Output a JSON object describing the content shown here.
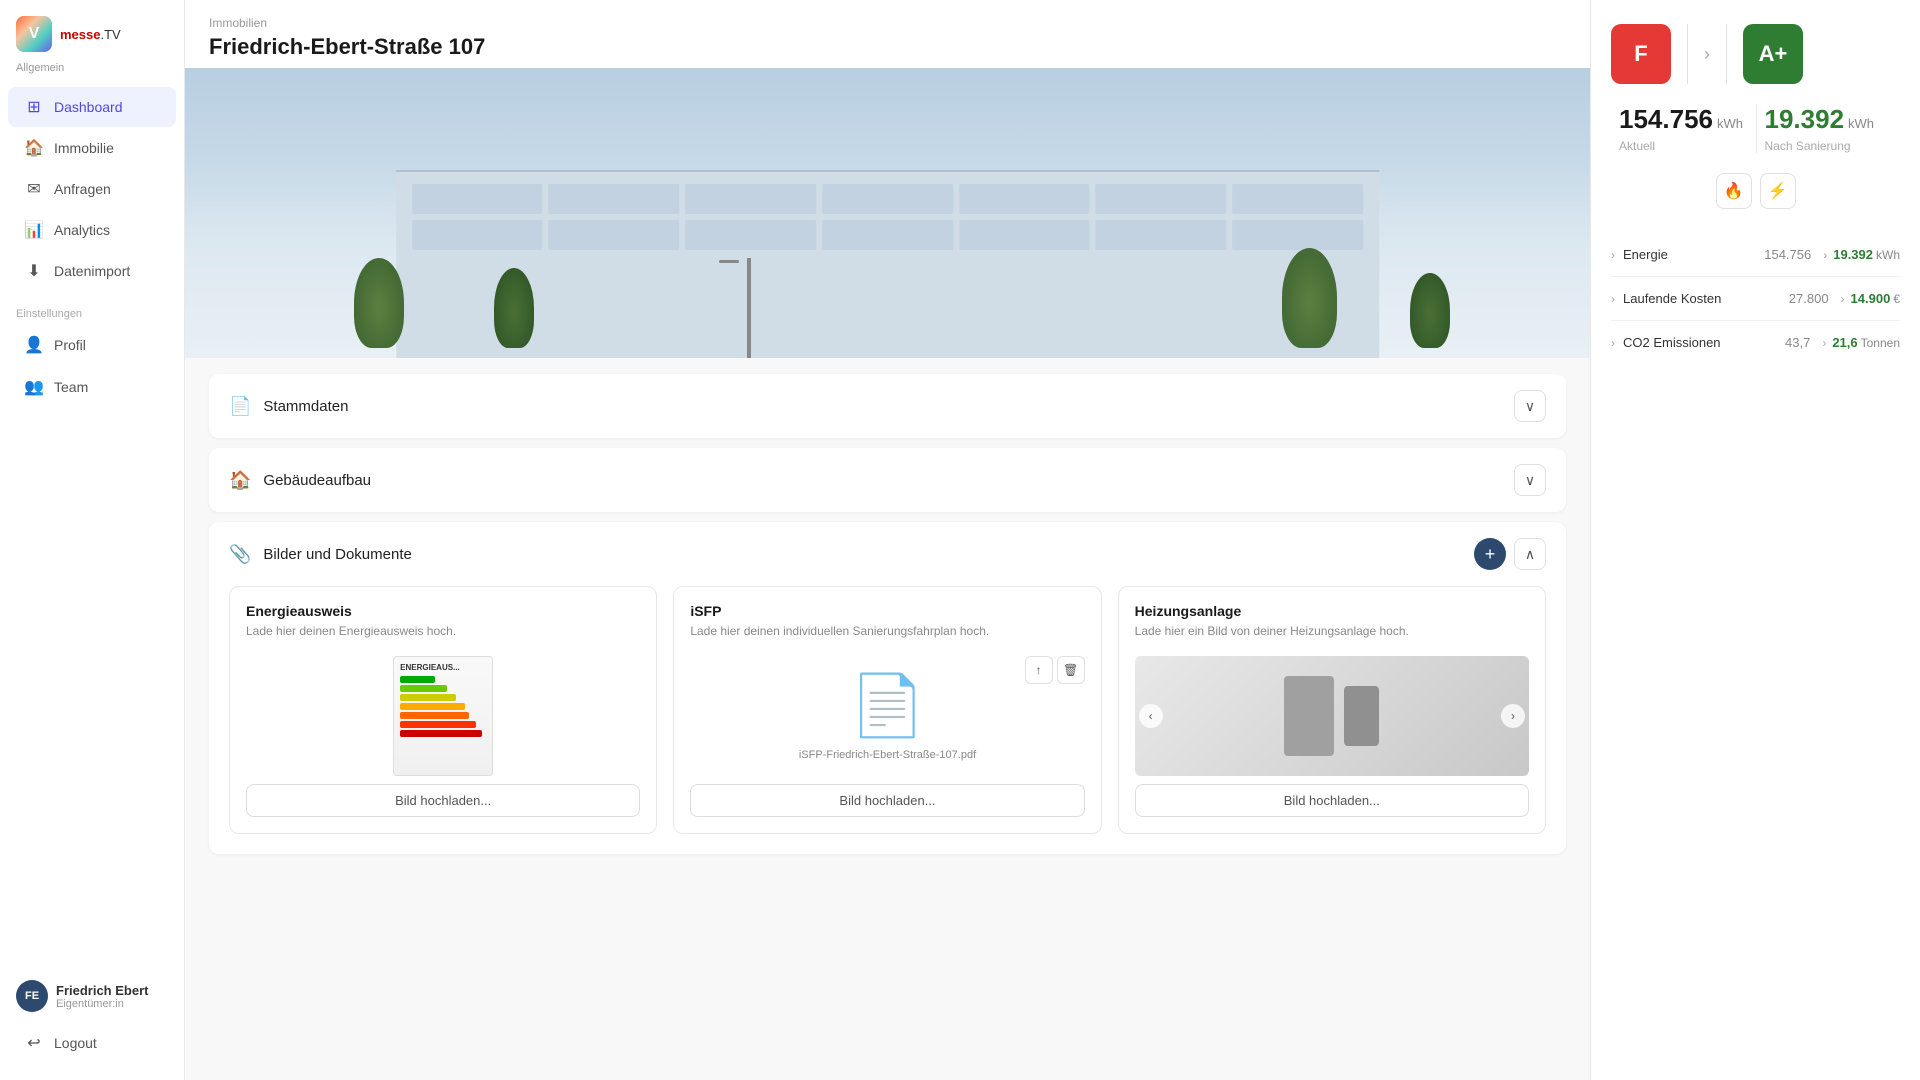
{
  "sidebar": {
    "logo_letter": "V",
    "logo_subtitle": "Allgemein",
    "logo_brand_prefix": "messe",
    "logo_brand_suffix": ".TV",
    "nav_items": [
      {
        "id": "dashboard",
        "label": "Dashboard",
        "icon": "⊞",
        "active": true
      },
      {
        "id": "immobilie",
        "label": "Immobilie",
        "icon": "🏠",
        "active": false
      },
      {
        "id": "anfragen",
        "label": "Anfragen",
        "icon": "✉",
        "active": false
      },
      {
        "id": "analytics",
        "label": "Analytics",
        "icon": "📊",
        "active": false
      },
      {
        "id": "datenimport",
        "label": "Datenimport",
        "icon": "⬇",
        "active": false
      }
    ],
    "settings_label": "Einstellungen",
    "settings_items": [
      {
        "id": "profil",
        "label": "Profil",
        "icon": "👤"
      },
      {
        "id": "team",
        "label": "Team",
        "icon": "👥"
      }
    ],
    "user": {
      "initials": "FE",
      "name": "Friedrich Ebert",
      "role": "Eigentümer:in"
    },
    "logout_label": "Logout"
  },
  "property": {
    "breadcrumb": "Immobilien",
    "title": "Friedrich-Ebert-Straße 107",
    "sections": [
      {
        "id": "stammdaten",
        "label": "Stammdaten",
        "icon": "📄",
        "expanded": false
      },
      {
        "id": "gebaeude",
        "label": "Gebäudeaufbau",
        "icon": "🏠",
        "expanded": false
      },
      {
        "id": "bilder",
        "label": "Bilder und Dokumente",
        "icon": "📎",
        "expanded": true
      }
    ],
    "documents": [
      {
        "id": "energieausweis",
        "title": "Energieausweis",
        "description": "Lade hier deinen Energieausweis hoch.",
        "type": "image",
        "upload_label": "Bild hochladen..."
      },
      {
        "id": "isfp",
        "title": "iSFP",
        "description": "Lade hier deinen individuellen Sanierungsfahrplan hoch.",
        "type": "file",
        "filename": "iSFP-Friedrich-Ebert-Straße-107.pdf",
        "upload_label": "Bild hochladen..."
      },
      {
        "id": "heizungsanlage",
        "title": "Heizungsanlage",
        "description": "Lade hier ein Bild von deiner Heizungsanlage hoch.",
        "type": "image_nav",
        "upload_label": "Bild hochladen..."
      }
    ]
  },
  "right_panel": {
    "badge_current": "F",
    "badge_after": "A+",
    "value_current": "154.756",
    "unit_current": "kWh",
    "label_current": "Aktuell",
    "value_after": "19.392",
    "unit_after": "kWh",
    "label_after": "Nach Sanierung",
    "metrics": [
      {
        "label": "Energie",
        "before": "154.756",
        "after": "19.392",
        "unit": "kWh"
      },
      {
        "label": "Laufende Kosten",
        "before": "27.800",
        "after": "14.900",
        "unit": "€"
      },
      {
        "label": "CO2 Emissionen",
        "before": "43,7",
        "after": "21,6",
        "unit": "Tonnen"
      }
    ]
  }
}
